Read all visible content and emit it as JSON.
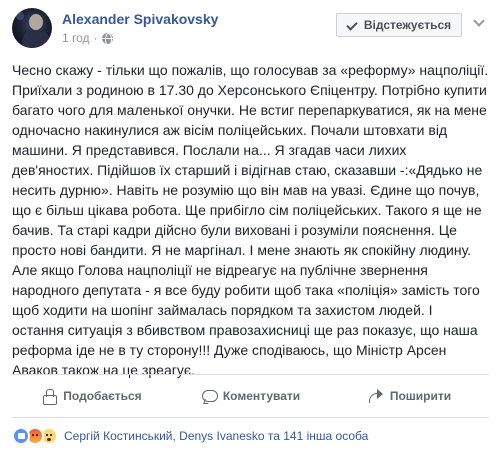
{
  "post": {
    "author": "Alexander Spivakovsky",
    "time": "1 год",
    "follow_label": "Відстежується",
    "text": "Чесно скажу - тільки що пожалів, що голосував за «реформу» нацполіції.\nПриїхали з родиною в 17.30 до Херсонського Єпіцентру. Потрібно купити\nбагато чого для маленької онучки. Не встиг перепаркуватися, як на мене\nодночасно накинулися аж вісім поліцейських. Почали штовхати від\nмашини. Я представився. Послали на... Я згадав часи лихих\nдев'яностих. Підійшов їх старший і відігнав стаю, сказавши -:«Дядько не\nнесить дурню». Навіть не розумію що він мав на увазі. Єдине що почув,\nщо є більш цікава робота. Ще прибігло сім поліцейських. Такого я ще не\nбачив. Та старі кадри дійсно були виховані і розуміли пояснення. Це\nпросто нові бандити. Я не маргінал. І мене знають як спокійну людину.\nАле якщо Голова нацполіції не відреагує на публічне звернення\nнародного депутата - я все буду робити щоб така «поліція» замість того\nщоб ходити на шопінг займалась порядком та захистом людей. І\nостання ситуація з вбивством правозахисниці ще раз показує, що наша\nреформа іде не в ту сторону!!! Дуже сподіваюсь, що Міністр Арсен\nАваков також на це зреагує."
  },
  "actions": {
    "like": "Подобається",
    "comment": "Коментувати",
    "share": "Поширити"
  },
  "reactions": {
    "names": "Сергій Костинський, Denys Ivanesko та 141 інша особа",
    "icons": [
      "like-reaction",
      "angry-reaction",
      "wow-reaction"
    ]
  },
  "colors": {
    "link": "#365899",
    "text": "#1d2129",
    "secondary": "#90949c"
  }
}
